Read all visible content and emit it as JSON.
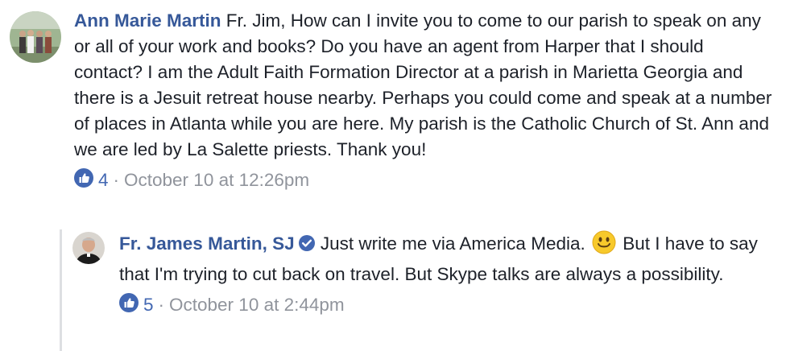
{
  "comments": [
    {
      "author": "Ann Marie Martin",
      "text": "Fr. Jim, How can I invite you to come to our parish to speak on any or all of your work and books? Do you have an agent from Harper that I should contact? I am the Adult Faith Formation Director at a parish in Marietta Georgia and there is a Jesuit retreat house nearby. Perhaps you could come and speak at a number of places in Atlanta while you are here. My parish is the Catholic Church of St. Ann and we are led by La Salette priests. Thank you!",
      "likes": "4",
      "separator": "·",
      "timestamp": "October 10 at 12:26pm"
    },
    {
      "author": "Fr. James Martin, SJ",
      "text_before_emoji": "Just write me via America Media.",
      "emoji": "smiley-emoji",
      "text_after_emoji": "But I have to say that I'm trying to cut back on travel. But Skype talks are always a possibility.",
      "likes": "5",
      "separator": "·",
      "timestamp": "October 10 at 2:44pm",
      "verified": true
    }
  ],
  "colors": {
    "author_link": "#365899",
    "meta_text": "#90949c",
    "like_icon": "#4267b2",
    "verified_badge": "#4267b2",
    "thread_line": "#dddfe2"
  },
  "icons": {
    "like": "thumbs-up-icon",
    "verified": "verified-badge-icon"
  }
}
